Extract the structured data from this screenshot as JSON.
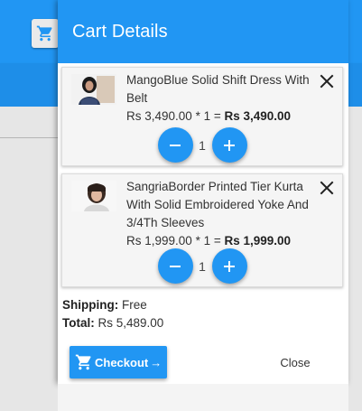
{
  "panel": {
    "title": "Cart Details",
    "items": [
      {
        "name": "MangoBlue Solid Shift Dress With Belt",
        "unit_price": "Rs 3,490.00",
        "multiplier": " * 1 = ",
        "line_total": "Rs 3,490.00",
        "quantity": "1"
      },
      {
        "name": "SangriaBorder Printed Tier Kurta With Solid Embroidered Yoke And 3/4Th Sleeves",
        "unit_price": "Rs 1,999.00",
        "multiplier": " * 1 = ",
        "line_total": "Rs 1,999.00",
        "quantity": "1"
      }
    ],
    "summary": {
      "shipping_label": "Shipping:",
      "shipping_value": " Free",
      "total_label": "Total:",
      "total_value": " Rs 5,489.00"
    },
    "actions": {
      "checkout_label": "Checkout",
      "checkout_arrow": "→",
      "close_label": "Close"
    }
  },
  "colors": {
    "primary": "#2196f3",
    "background": "#e6e6e6"
  },
  "icons": {
    "cart": "shopping-cart-icon",
    "remove": "close-icon",
    "decrease": "minus-icon",
    "increase": "plus-icon"
  }
}
